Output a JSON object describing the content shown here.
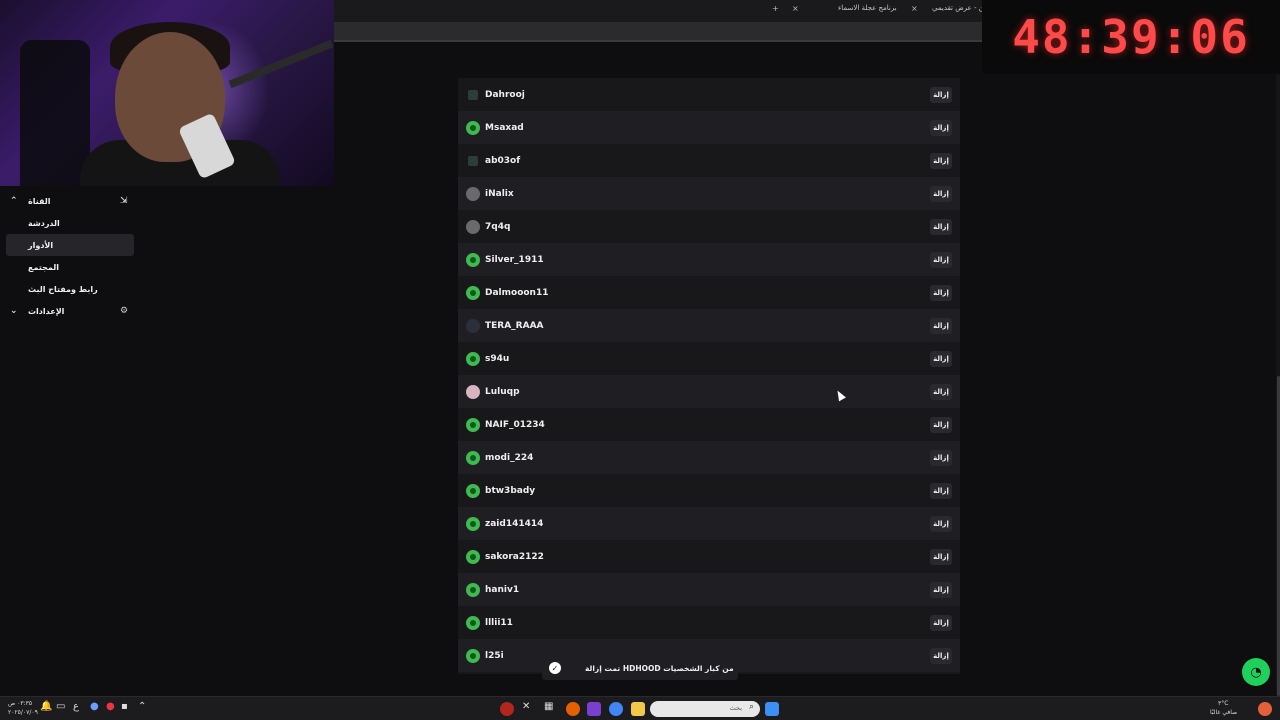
{
  "browser": {
    "tab_1": "مين - عرض تقديمي",
    "tab_2": "برنامج عجلة الاسماء",
    "new_tab_glyph": "+",
    "close_glyph": "×"
  },
  "timer": {
    "display": "48:39:06",
    "color": "#ff4a4a"
  },
  "sidebar": {
    "items": [
      {
        "label": "القناة",
        "expanded": true
      },
      {
        "label": "الدردشة"
      },
      {
        "label": "الأدوار",
        "active": true
      },
      {
        "label": "المجتمع"
      },
      {
        "label": "رابط ومفتاح البث"
      },
      {
        "label": "الإعدادات",
        "expanded": false
      }
    ]
  },
  "users": {
    "remove_label": "إزالة",
    "rows": [
      {
        "name": "Dahrooj",
        "avatar": "small"
      },
      {
        "name": "Msaxad",
        "avatar": "green"
      },
      {
        "name": "ab03of",
        "avatar": "small"
      },
      {
        "name": "iNalix",
        "avatar": "gray"
      },
      {
        "name": "7q4q",
        "avatar": "gray"
      },
      {
        "name": "Silver_1911",
        "avatar": "green"
      },
      {
        "name": "Dalmooon11",
        "avatar": "green"
      },
      {
        "name": "TERA_RAAA",
        "avatar": "dark"
      },
      {
        "name": "s94u",
        "avatar": "green"
      },
      {
        "name": "Luluqp",
        "avatar": "pink"
      },
      {
        "name": "NAIF_01234",
        "avatar": "green"
      },
      {
        "name": "modi_224",
        "avatar": "green"
      },
      {
        "name": "btw3bady",
        "avatar": "green"
      },
      {
        "name": "zaid141414",
        "avatar": "green"
      },
      {
        "name": "sakora2122",
        "avatar": "green"
      },
      {
        "name": "haniv1",
        "avatar": "green"
      },
      {
        "name": "lllii11",
        "avatar": "green"
      },
      {
        "name": "l25i",
        "avatar": "green"
      }
    ]
  },
  "toast": {
    "message": "تمت إزالة HDHOOD من كبار الشخصيات",
    "check": "✓"
  },
  "taskbar": {
    "search_placeholder": "بحث",
    "clock_time": "٠٣:٣٥ ص",
    "clock_date": "٢٠٢٥/٠٧/٠٩",
    "weather_temp": "٣°C",
    "weather_desc": "صافي غالبًا"
  },
  "colors": {
    "accent_green": "#1fd15b",
    "panel_bg": "#18181b"
  }
}
